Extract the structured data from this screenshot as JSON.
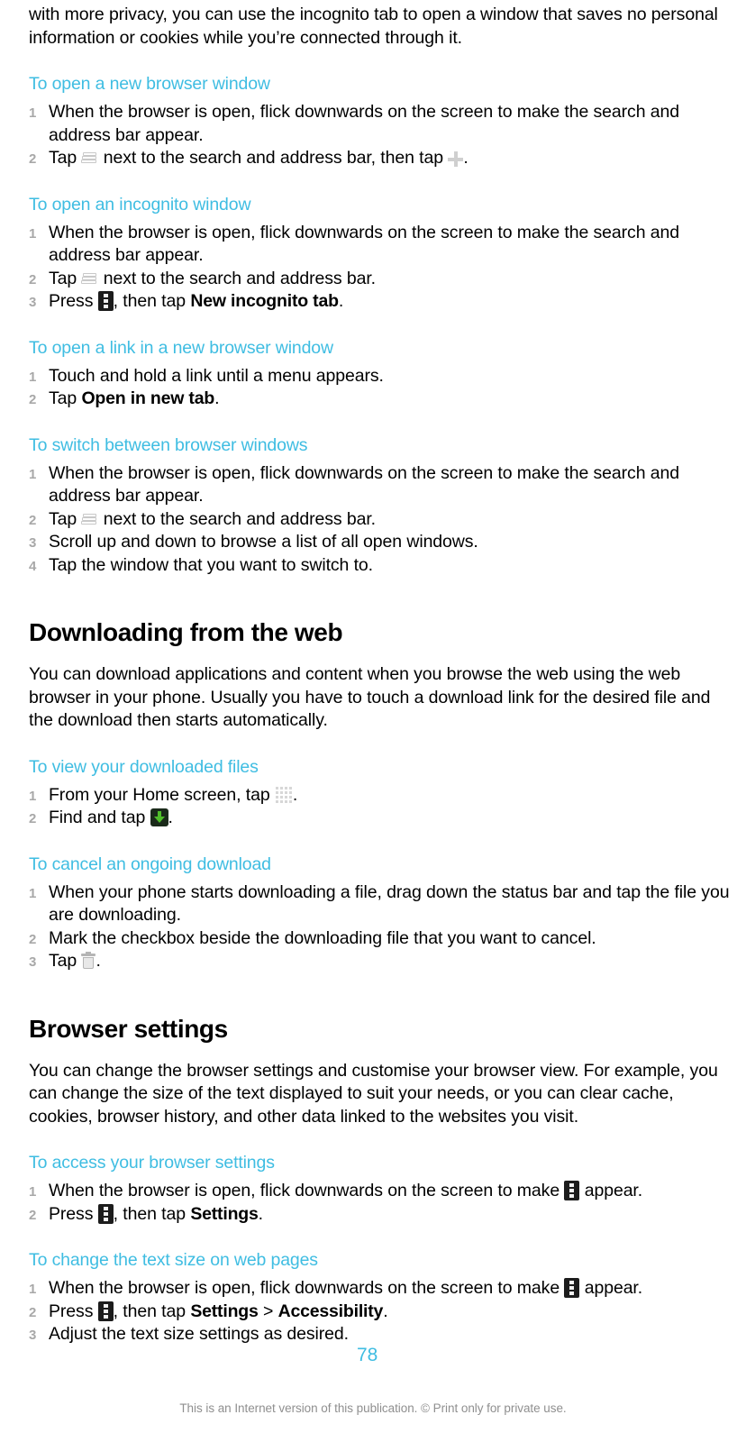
{
  "document": {
    "page_number": "78",
    "footer": "This is an Internet version of this publication. © Print only for private use.",
    "accent_color": "#3fbde2",
    "text_color": "#000000",
    "background_color": "#ffffff"
  },
  "intro": {
    "continued_paragraph": "with more privacy, you can use the incognito tab to open a window that saves no personal information or cookies while you’re connected through it."
  },
  "sections": [
    {
      "heading": "To open a new browser window",
      "steps": [
        {
          "num": "1",
          "pre": "When the browser is open, flick downwards on the screen to make the search and address bar appear.",
          "post": ""
        },
        {
          "num": "2",
          "pre": "Tap ",
          "icon1": "browser-tabs-icon",
          "mid": " next to the search and address bar, then tap ",
          "icon2": "plus-icon",
          "post": "."
        }
      ]
    },
    {
      "heading": "To open an incognito window",
      "steps": [
        {
          "num": "1",
          "pre": "When the browser is open, flick downwards on the screen to make the search and address bar appear.",
          "post": ""
        },
        {
          "num": "2",
          "pre": "Tap ",
          "icon1": "browser-tabs-icon",
          "post": " next to the search and address bar."
        },
        {
          "num": "3",
          "pre": "Press ",
          "icon1": "menu-key-icon",
          "mid": ", then tap ",
          "bold": "New incognito tab",
          "post": "."
        }
      ]
    },
    {
      "heading": "To open a link in a new browser window",
      "steps": [
        {
          "num": "1",
          "pre": "Touch and hold a link until a menu appears.",
          "post": ""
        },
        {
          "num": "2",
          "pre": "Tap ",
          "bold": "Open in new tab",
          "post": "."
        }
      ]
    },
    {
      "heading": "To switch between browser windows",
      "steps": [
        {
          "num": "1",
          "pre": "When the browser is open, flick downwards on the screen to make the search and address bar appear.",
          "post": ""
        },
        {
          "num": "2",
          "pre": "Tap ",
          "icon1": "browser-tabs-icon",
          "post": " next to the search and address bar."
        },
        {
          "num": "3",
          "pre": "Scroll up and down to browse a list of all open windows.",
          "post": ""
        },
        {
          "num": "4",
          "pre": "Tap the window that you want to switch to.",
          "post": ""
        }
      ]
    }
  ],
  "chapter_downloading": {
    "title": "Downloading from the web",
    "body": "You can download applications and content when you browse the web using the web browser in your phone. Usually you have to touch a download link for the desired file and the download then starts automatically.",
    "sections": [
      {
        "heading": "To view your downloaded files",
        "steps": [
          {
            "num": "1",
            "pre": "From your Home screen, tap ",
            "icon1": "app-drawer-grid-icon",
            "post": "."
          },
          {
            "num": "2",
            "pre": "Find and tap ",
            "icon1": "downloads-app-icon",
            "post": "."
          }
        ]
      },
      {
        "heading": "To cancel an ongoing download",
        "steps": [
          {
            "num": "1",
            "pre": "When your phone starts downloading a file, drag down the status bar and tap the file you are downloading.",
            "post": ""
          },
          {
            "num": "2",
            "pre": "Mark the checkbox beside the downloading file that you want to cancel.",
            "post": ""
          },
          {
            "num": "3",
            "pre": "Tap ",
            "icon1": "trash-bin-icon",
            "post": "."
          }
        ]
      }
    ]
  },
  "chapter_browser_settings": {
    "title": "Browser settings",
    "body": "You can change the browser settings and customise your browser view. For example, you can change the size of the text displayed to suit your needs, or you can clear cache, cookies, browser history, and other data linked to the websites you visit.",
    "sections": [
      {
        "heading": "To access your browser settings",
        "steps": [
          {
            "num": "1",
            "pre": "When the browser is open, flick downwards on the screen to make ",
            "icon1": "menu-key-icon",
            "post": " appear."
          },
          {
            "num": "2",
            "pre": "Press ",
            "icon1": "menu-key-icon",
            "mid": ", then tap ",
            "bold": "Settings",
            "post": "."
          }
        ]
      },
      {
        "heading": "To change the text size on web pages",
        "steps": [
          {
            "num": "1",
            "pre": "When the browser is open, flick downwards on the screen to make ",
            "icon1": "menu-key-icon",
            "post": " appear."
          },
          {
            "num": "2",
            "pre": "Press ",
            "icon1": "menu-key-icon",
            "mid": ", then tap ",
            "bold": "Settings",
            "mid2": " > ",
            "bold2": "Accessibility",
            "post": "."
          },
          {
            "num": "3",
            "pre": "Adjust the text size settings as desired.",
            "post": ""
          }
        ]
      }
    ]
  }
}
